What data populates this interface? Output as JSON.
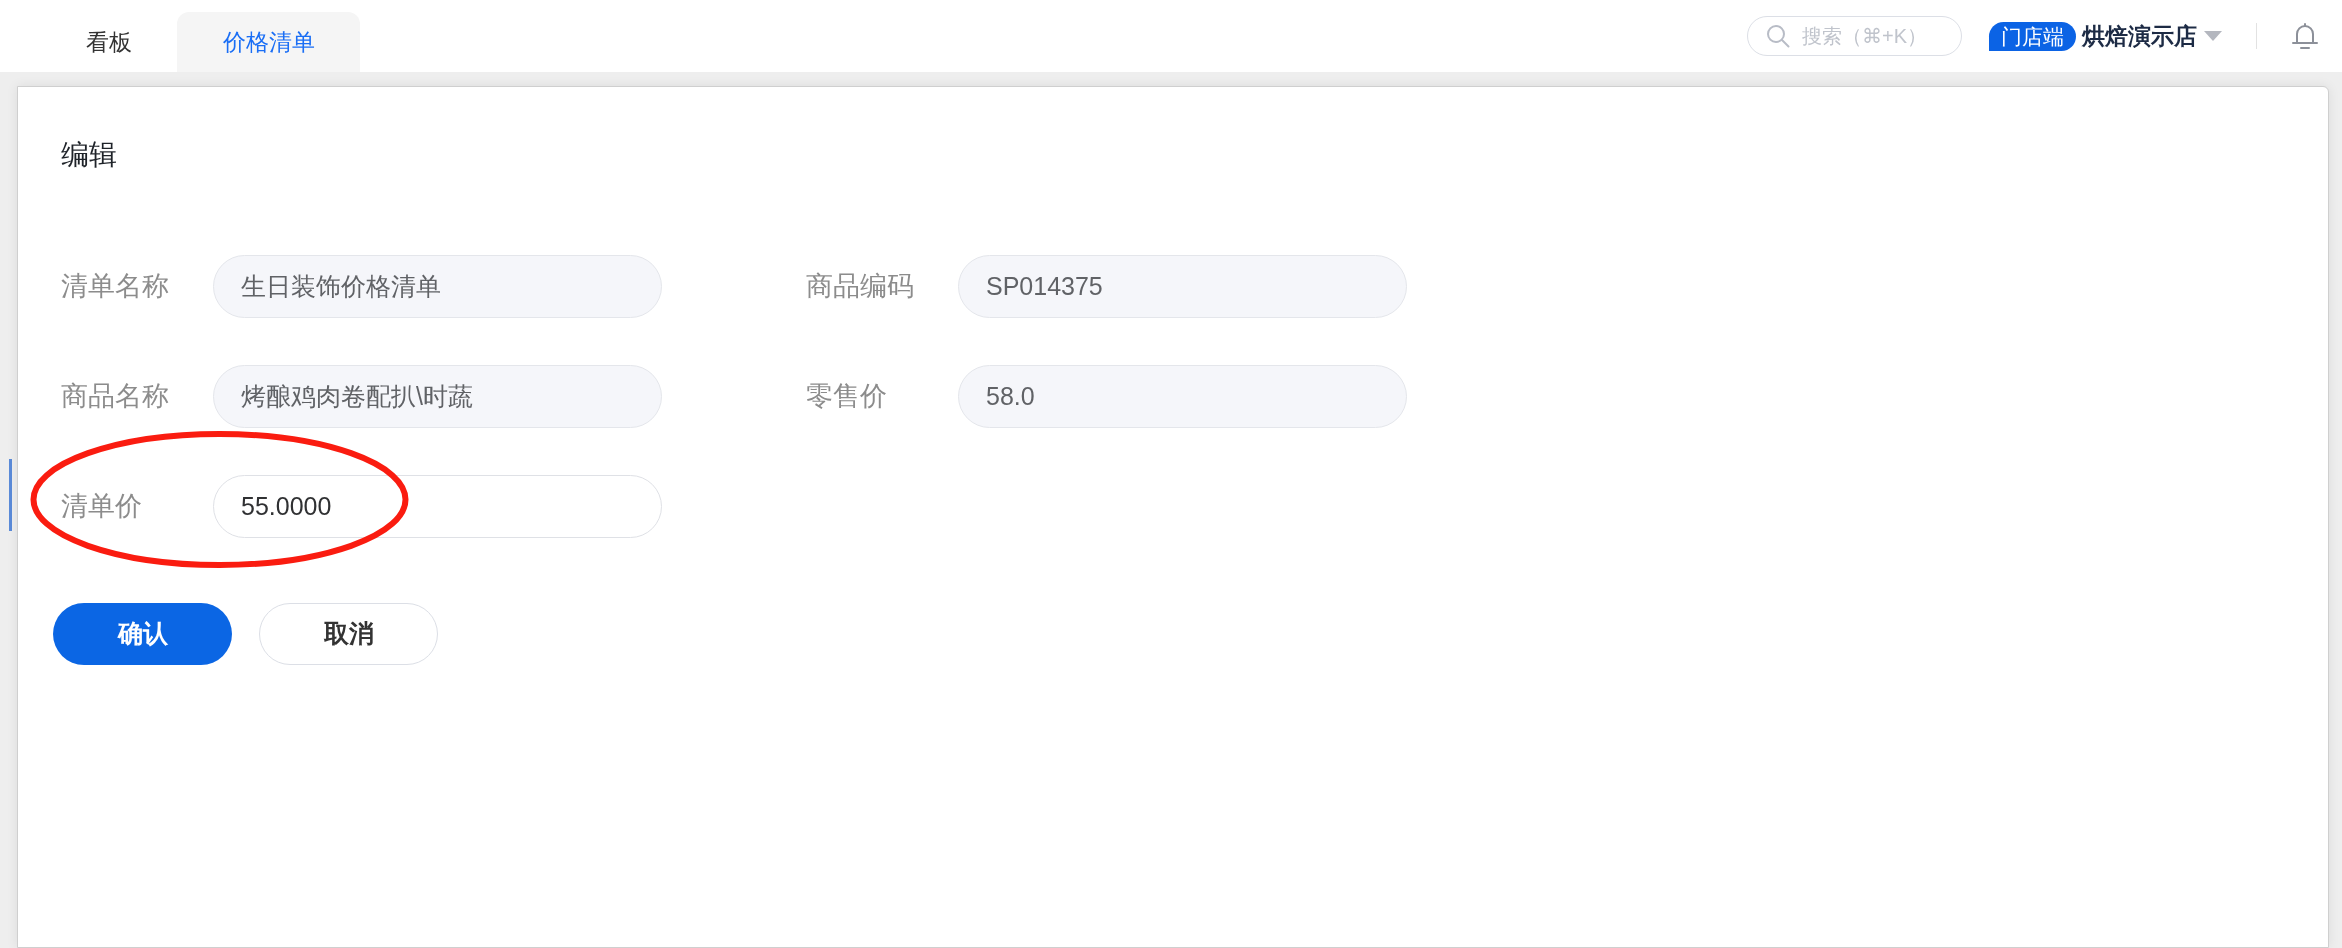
{
  "tabs": [
    {
      "label": "看板",
      "selected": false
    },
    {
      "label": "价格清单",
      "selected": true
    }
  ],
  "header": {
    "search": {
      "placeholder": "搜索（⌘+K）"
    },
    "store_badge": "门店端",
    "store_name": "烘焙演示店"
  },
  "dialog": {
    "title": "编辑",
    "fields": [
      {
        "label": "清单名称",
        "value": "生日装饰价格清单",
        "disabled": true,
        "highlighted": false
      },
      {
        "label": "商品编码",
        "value": "SP014375",
        "disabled": true,
        "highlighted": false
      },
      {
        "label": "商品名称",
        "value": "烤酿鸡肉卷配扒\\时蔬",
        "disabled": true,
        "highlighted": false
      },
      {
        "label": "零售价",
        "value": "58.0",
        "disabled": true,
        "highlighted": false
      },
      {
        "label": "清单价",
        "value": "55.0000",
        "disabled": false,
        "highlighted": true
      }
    ],
    "buttons": [
      {
        "label": "确认",
        "kind": "primary"
      },
      {
        "label": "取消",
        "kind": "default"
      }
    ]
  }
}
